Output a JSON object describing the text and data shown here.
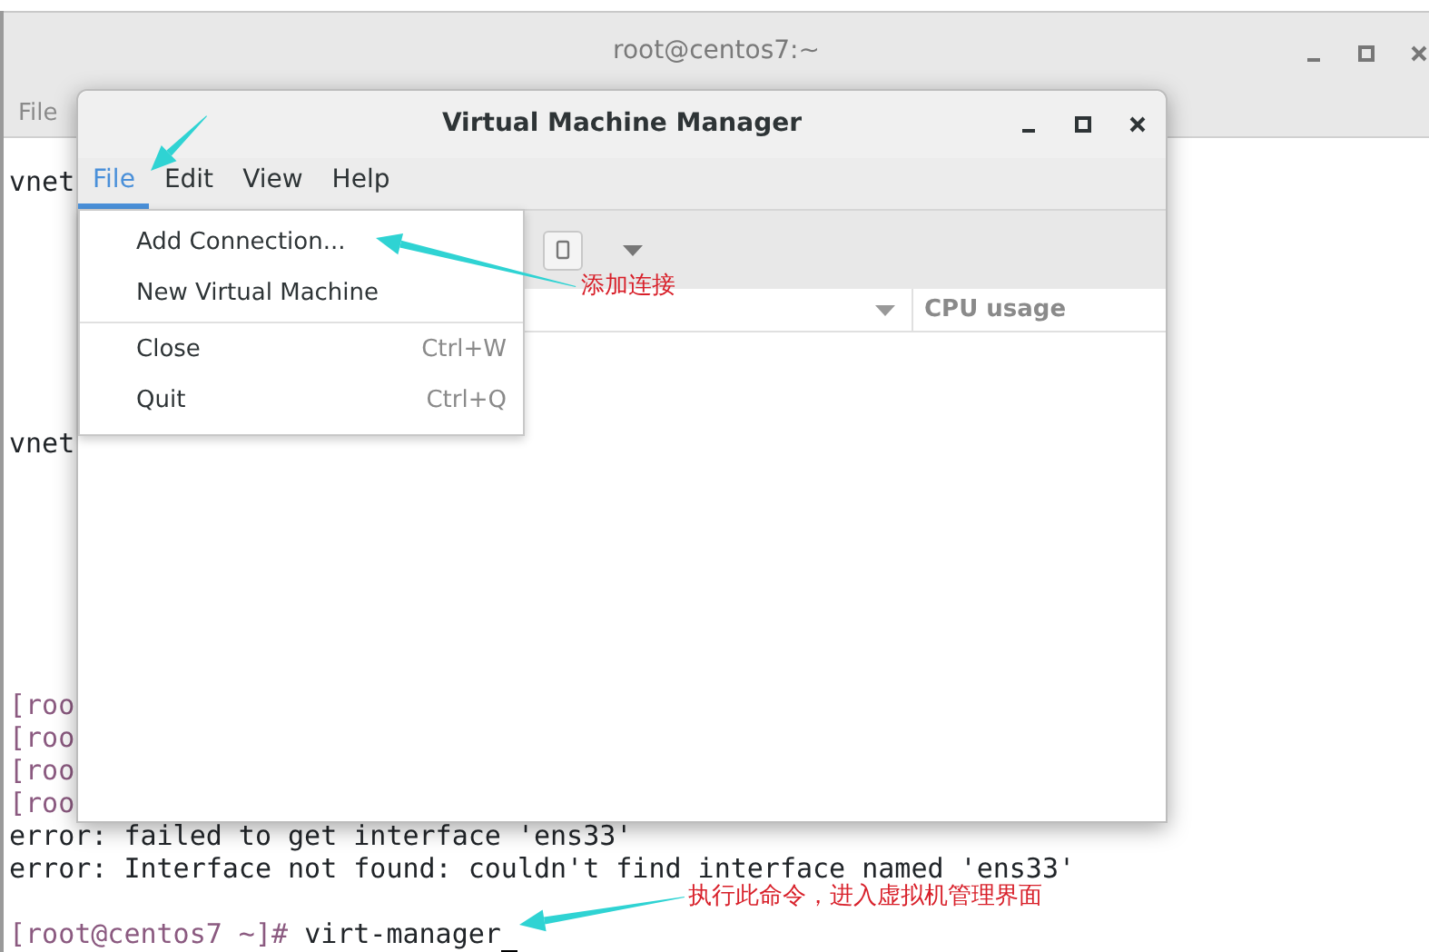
{
  "terminal": {
    "title": "root@centos7:~",
    "menu": [
      "File"
    ],
    "lines": [
      {
        "kind": "output",
        "text": "vnet"
      },
      {
        "kind": "blank"
      },
      {
        "kind": "blank"
      },
      {
        "kind": "blank"
      },
      {
        "kind": "blank"
      },
      {
        "kind": "blank"
      },
      {
        "kind": "blank"
      },
      {
        "kind": "blank"
      },
      {
        "kind": "output",
        "text": "vnet"
      },
      {
        "kind": "blank"
      },
      {
        "kind": "blank"
      },
      {
        "kind": "blank"
      },
      {
        "kind": "blank"
      },
      {
        "kind": "blank"
      },
      {
        "kind": "blank"
      },
      {
        "kind": "blank"
      },
      {
        "kind": "prompt",
        "text": "[roo"
      },
      {
        "kind": "prompt",
        "text": "[roo"
      },
      {
        "kind": "prompt",
        "text": "[roo"
      },
      {
        "kind": "prompt",
        "text": "[roo"
      },
      {
        "kind": "output",
        "text": "error: failed to get interface 'ens33'"
      },
      {
        "kind": "output",
        "text": "error: Interface not found: couldn't find interface named 'ens33'"
      },
      {
        "kind": "blank"
      },
      {
        "kind": "command",
        "prompt": "[root@centos7 ~]#",
        "text": "virt-manager"
      }
    ]
  },
  "vmm": {
    "title": "Virtual Machine Manager",
    "menu": [
      {
        "label": "File",
        "selected": true
      },
      {
        "label": "Edit",
        "selected": false
      },
      {
        "label": "View",
        "selected": false
      },
      {
        "label": "Help",
        "selected": false
      }
    ],
    "file_menu": [
      {
        "label": "Add Connection...",
        "separator_before": false
      },
      {
        "label": "New Virtual Machine",
        "separator_before": false
      },
      {
        "label": "Close",
        "shortcut": "Ctrl+W",
        "separator_before": true
      },
      {
        "label": "Quit",
        "shortcut": "Ctrl+Q",
        "separator_before": false
      }
    ],
    "columns": [
      "CPU usage"
    ]
  },
  "annotations": [
    {
      "text": "添加连接"
    },
    {
      "text": "执行此命令，进入虚拟机管理界面"
    }
  ]
}
